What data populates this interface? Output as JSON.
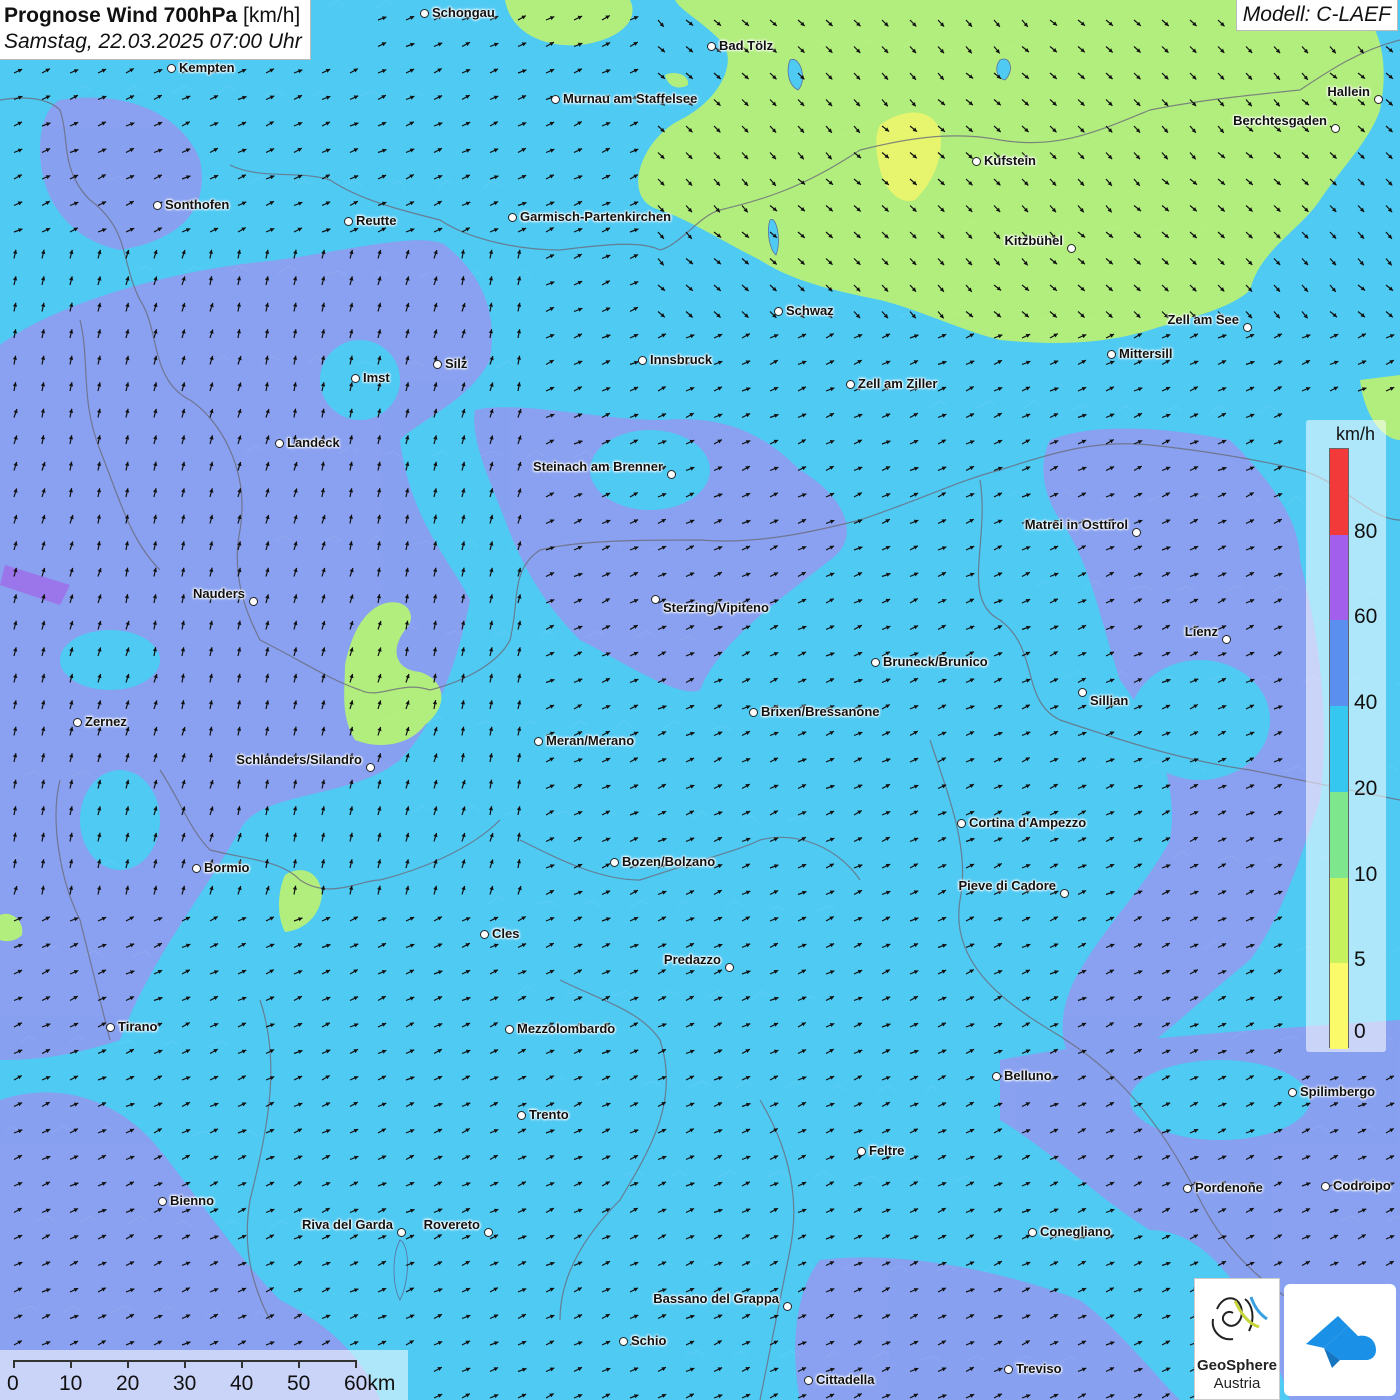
{
  "header": {
    "title_bold": "Prognose Wind 700hPa",
    "title_unit": " [km/h]",
    "datetime": "Samstag, 22.03.2025 07:00 Uhr",
    "model": "Modell: C-LAEF"
  },
  "legend": {
    "unit": "km/h",
    "labels": [
      "80",
      "60",
      "40",
      "20",
      "10",
      "5",
      "0"
    ],
    "colors": [
      "#f23a3a",
      "#a15fec",
      "#5a8ff0",
      "#35c7f0",
      "#7ee68d",
      "#c6f25d",
      "#fbfa6b"
    ]
  },
  "scale": {
    "labels": [
      "0",
      "10",
      "20",
      "30",
      "40",
      "50",
      "60km"
    ]
  },
  "logos": {
    "geosphere_line1": "GeoSphere",
    "geosphere_line2": "Austria"
  },
  "wind": {
    "direction": "north-east",
    "arrow_icon": "wind-arrow-icon"
  },
  "colors": {
    "sea_blue": "#4fcaf3",
    "purple": "#8f9cf0",
    "green": "#b2ee7d",
    "yellow": "#e6f56d"
  },
  "cities": [
    {
      "name": "Schongau"
    },
    {
      "name": "Bad Tölz"
    },
    {
      "name": "Kempten"
    },
    {
      "name": "Murnau am Staffelsee"
    },
    {
      "name": "Hallein"
    },
    {
      "name": "Berchtesgaden"
    },
    {
      "name": "Kufstein"
    },
    {
      "name": "Sonthofen"
    },
    {
      "name": "Reutte"
    },
    {
      "name": "Garmisch-Partenkirchen"
    },
    {
      "name": "Kitzbühel"
    },
    {
      "name": "Schwaz"
    },
    {
      "name": "Zell am See"
    },
    {
      "name": "Mittersill"
    },
    {
      "name": "Innsbruck"
    },
    {
      "name": "Silz"
    },
    {
      "name": "Imst"
    },
    {
      "name": "Zell am Ziller"
    },
    {
      "name": "Landeck"
    },
    {
      "name": "Steinach am Brenner"
    },
    {
      "name": "Matrei in Osttirol"
    },
    {
      "name": "Nauders"
    },
    {
      "name": "Sterzing/Vipiteno"
    },
    {
      "name": "Lienz"
    },
    {
      "name": "Bruneck/Brunico"
    },
    {
      "name": "Sillian"
    },
    {
      "name": "Brixen/Bressanone"
    },
    {
      "name": "Zernez"
    },
    {
      "name": "Meran/Merano"
    },
    {
      "name": "Schlanders/Silandro"
    },
    {
      "name": "Cortina d'Ampezzo"
    },
    {
      "name": "Bozen/Bolzano"
    },
    {
      "name": "Bormio"
    },
    {
      "name": "Pieve di Cadore"
    },
    {
      "name": "Cles"
    },
    {
      "name": "Predazzo"
    },
    {
      "name": "Tirano"
    },
    {
      "name": "Mezzolombardo"
    },
    {
      "name": "Belluno"
    },
    {
      "name": "Spilimbergo"
    },
    {
      "name": "Trento"
    },
    {
      "name": "Feltre"
    },
    {
      "name": "Pordenone"
    },
    {
      "name": "Codroipo"
    },
    {
      "name": "Bienno"
    },
    {
      "name": "Riva del Garda"
    },
    {
      "name": "Rovereto"
    },
    {
      "name": "Conegliano"
    },
    {
      "name": "Bassano del Grappa"
    },
    {
      "name": "Schio"
    },
    {
      "name": "Treviso"
    },
    {
      "name": "Cittadella"
    }
  ]
}
